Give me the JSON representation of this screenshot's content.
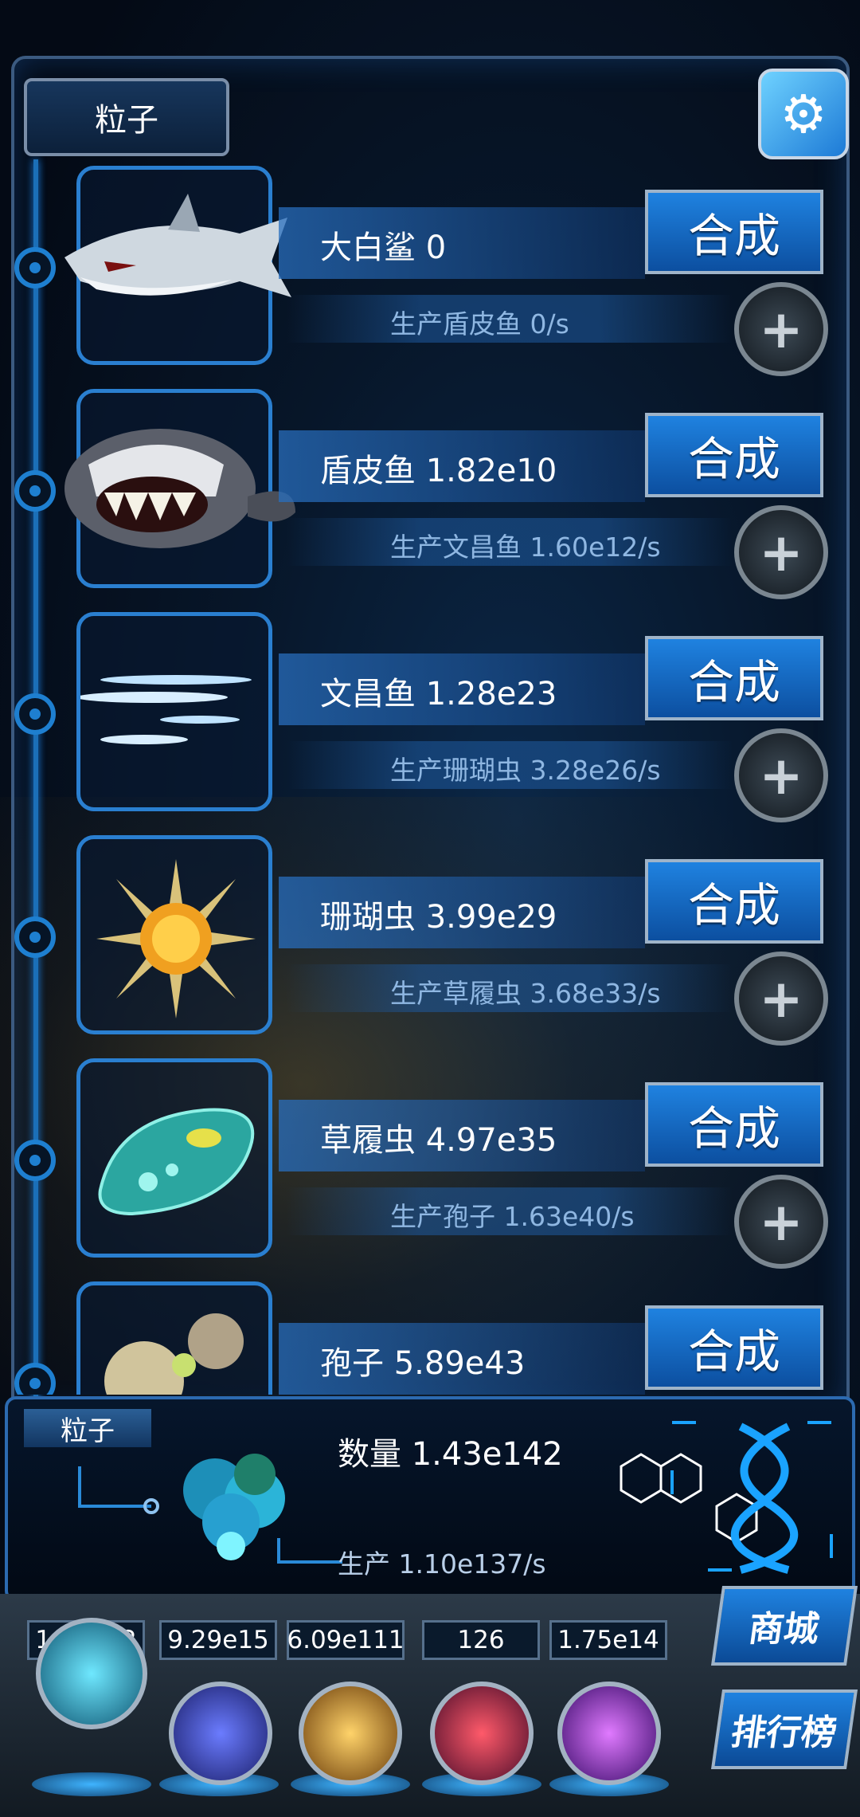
{
  "header": {
    "tab_label": "粒子",
    "settings_icon": "gear-icon"
  },
  "creatures": [
    {
      "name": "大白鲨 0",
      "production": "生产盾皮鱼 0/s",
      "combine_label": "合成",
      "icon": "shark-icon"
    },
    {
      "name": "盾皮鱼 1.82e10",
      "production": "生产文昌鱼 1.60e12/s",
      "combine_label": "合成",
      "icon": "placoderm-icon"
    },
    {
      "name": "文昌鱼 1.28e23",
      "production": "生产珊瑚虫 3.28e26/s",
      "combine_label": "合成",
      "icon": "lancelet-icon"
    },
    {
      "name": "珊瑚虫 3.99e29",
      "production": "生产草履虫 3.68e33/s",
      "combine_label": "合成",
      "icon": "coral-polyp-icon"
    },
    {
      "name": "草履虫 4.97e35",
      "production": "生产孢子 1.63e40/s",
      "combine_label": "合成",
      "icon": "paramecium-icon"
    },
    {
      "name": "孢子 5.89e43",
      "production": "",
      "combine_label": "合成",
      "icon": "spore-icon"
    }
  ],
  "particle_panel": {
    "tab_label": "粒子",
    "quantity": "数量 1.43e142",
    "production": "生产 1.10e137/s"
  },
  "resources": [
    {
      "value": "1.22e42",
      "icon": "particle-orb-icon"
    },
    {
      "value": "9.29e15",
      "icon": "lightning-orb-icon"
    },
    {
      "value": "6.09e111",
      "icon": "galaxy-orb-icon"
    },
    {
      "value": "126",
      "icon": "brain-orb-icon"
    },
    {
      "value": "1.75e14",
      "icon": "vortex-orb-icon"
    }
  ],
  "side_buttons": {
    "shop": "商城",
    "rank": "排行榜"
  }
}
